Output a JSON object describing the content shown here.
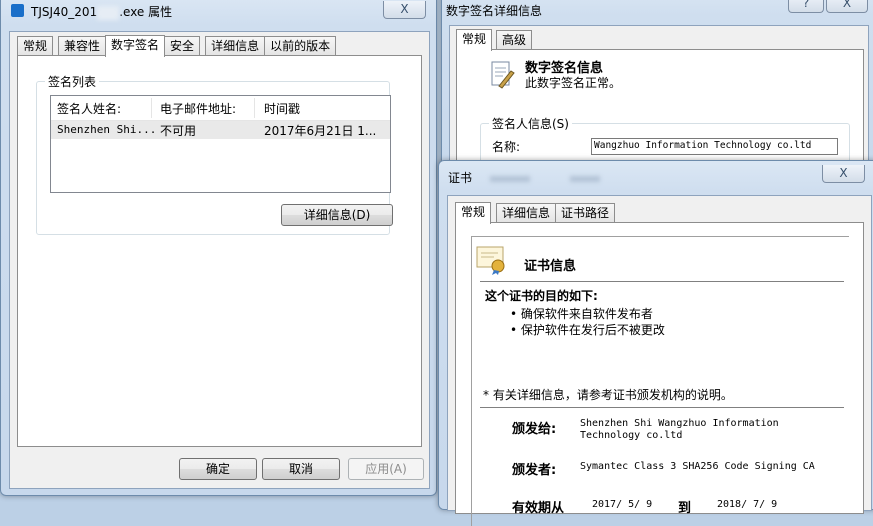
{
  "props": {
    "title_prefix": "TJSJ40_201",
    "title_suffix": ".exe 属性",
    "close": "X",
    "tabs": [
      "常规",
      "兼容性",
      "数字签名",
      "安全",
      "详细信息",
      "以前的版本"
    ],
    "sig_list_label": "签名列表",
    "columns": [
      "签名人姓名:",
      "电子邮件地址:",
      "时间戳"
    ],
    "rows": [
      [
        "Shenzhen Shi...",
        "不可用",
        "2017年6月21日 1..."
      ]
    ],
    "details_btn": "详细信息(D)",
    "ok": "确定",
    "cancel": "取消",
    "apply": "应用(A)"
  },
  "sigdetail": {
    "title": "数字签名详细信息",
    "help": "?",
    "close": "X",
    "tabs": [
      "常规",
      "高级"
    ],
    "heading": "数字签名信息",
    "status": "此数字签名正常。",
    "signer_label": "签名人信息(S)",
    "name_label": "名称:",
    "name_value": "Wangzhuo Information Technology co.ltd"
  },
  "cert": {
    "title": "证书",
    "close": "X",
    "tabs": [
      "常规",
      "详细信息",
      "证书路径"
    ],
    "heading": "证书信息",
    "purpose_title": "这个证书的目的如下:",
    "purposes": [
      "确保软件来自软件发布者",
      "保护软件在发行后不被更改"
    ],
    "note": "* 有关详细信息，请参考证书颁发机构的说明。",
    "issued_to_label": "颁发给:",
    "issued_to_line1": "Shenzhen Shi Wangzhuo Information",
    "issued_to_line2": "Technology co.ltd",
    "issued_by_label": "颁发者:",
    "issued_by_value": "Symantec Class 3 SHA256 Code Signing CA",
    "valid_label": "有效期从",
    "valid_from": "2017/ 5/ 9",
    "valid_to_word": "到",
    "valid_to": "2018/ 7/ 9"
  }
}
